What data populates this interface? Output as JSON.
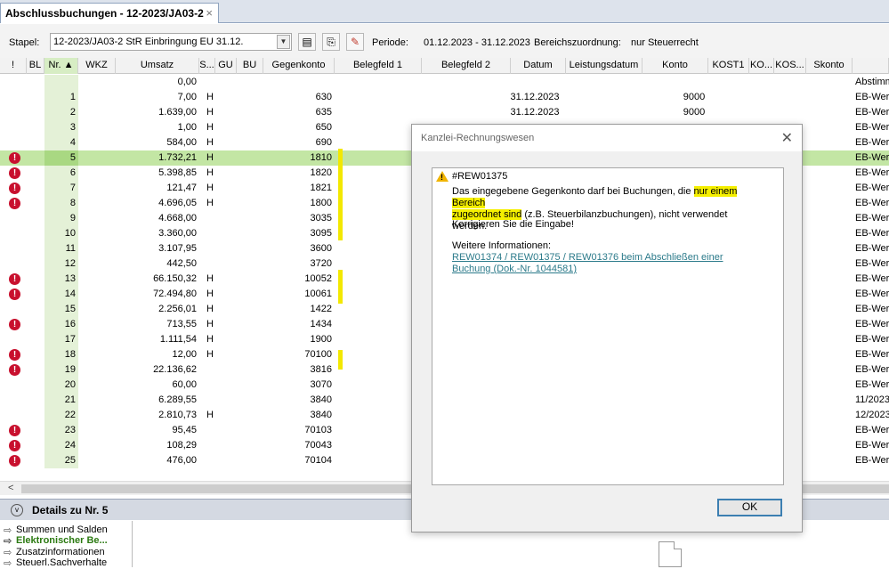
{
  "tab": {
    "title": "Abschlussbuchungen - 12-2023/JA03-2",
    "close": "×"
  },
  "toolbar": {
    "stapel_label": "Stapel:",
    "stapel_value": "12-2023/JA03-2  StR Einbringung EU 31.12.",
    "periode_label": "Periode:",
    "periode_value": "01.12.2023 - 31.12.2023",
    "bereich_label": "Bereichszuordnung:",
    "bereich_value": "nur Steuerrecht"
  },
  "columns": [
    "!",
    "BL",
    "Nr.",
    "WKZ",
    "Umsatz",
    "S...",
    "GU",
    "BU",
    "Gegenkonto",
    "Belegfeld 1",
    "Belegfeld 2",
    "Datum",
    "Leistungsdatum",
    "Konto",
    "KOST1",
    "KO...",
    "KOS...",
    "Skonto",
    ""
  ],
  "rows": [
    {
      "err": false,
      "nr": "",
      "umsatz": "0,00",
      "s": "",
      "gk": "",
      "datum": "",
      "konto": "",
      "last": "Abstimm"
    },
    {
      "err": false,
      "nr": "1",
      "umsatz": "7,00",
      "s": "H",
      "gk": "630",
      "datum": "31.12.2023",
      "konto": "9000",
      "last": "EB-Wert"
    },
    {
      "err": false,
      "nr": "2",
      "umsatz": "1.639,00",
      "s": "H",
      "gk": "635",
      "datum": "31.12.2023",
      "konto": "9000",
      "last": "EB-Wert"
    },
    {
      "err": false,
      "nr": "3",
      "umsatz": "1,00",
      "s": "H",
      "gk": "650",
      "datum": "",
      "konto": "",
      "last": "EB-Wert"
    },
    {
      "err": false,
      "nr": "4",
      "umsatz": "584,00",
      "s": "H",
      "gk": "690",
      "datum": "",
      "konto": "",
      "last": "EB-Wert"
    },
    {
      "err": true,
      "nr": "5",
      "umsatz": "1.732,21",
      "s": "H",
      "gk": "1810",
      "datum": "",
      "konto": "",
      "last": "EB-Wert"
    },
    {
      "err": true,
      "nr": "6",
      "umsatz": "5.398,85",
      "s": "H",
      "gk": "1820",
      "datum": "",
      "konto": "",
      "last": "EB-Wert"
    },
    {
      "err": true,
      "nr": "7",
      "umsatz": "121,47",
      "s": "H",
      "gk": "1821",
      "datum": "",
      "konto": "",
      "last": "EB-Wert"
    },
    {
      "err": true,
      "nr": "8",
      "umsatz": "4.696,05",
      "s": "H",
      "gk": "1800",
      "datum": "",
      "konto": "",
      "last": "EB-Wert"
    },
    {
      "err": false,
      "nr": "9",
      "umsatz": "4.668,00",
      "s": "",
      "gk": "3035",
      "datum": "",
      "konto": "",
      "last": "EB-Wert"
    },
    {
      "err": false,
      "nr": "10",
      "umsatz": "3.360,00",
      "s": "",
      "gk": "3095",
      "datum": "",
      "konto": "",
      "last": "EB-Wert"
    },
    {
      "err": false,
      "nr": "11",
      "umsatz": "3.107,95",
      "s": "",
      "gk": "3600",
      "datum": "",
      "konto": "",
      "last": "EB-Wert"
    },
    {
      "err": false,
      "nr": "12",
      "umsatz": "442,50",
      "s": "",
      "gk": "3720",
      "datum": "",
      "konto": "",
      "last": "EB-Wert"
    },
    {
      "err": true,
      "nr": "13",
      "umsatz": "66.150,32",
      "s": "H",
      "gk": "10052",
      "datum": "",
      "konto": "",
      "last": "EB-Wert"
    },
    {
      "err": true,
      "nr": "14",
      "umsatz": "72.494,80",
      "s": "H",
      "gk": "10061",
      "datum": "",
      "konto": "",
      "last": "EB-Wert"
    },
    {
      "err": false,
      "nr": "15",
      "umsatz": "2.256,01",
      "s": "H",
      "gk": "1422",
      "datum": "",
      "konto": "",
      "last": "EB-Wert"
    },
    {
      "err": true,
      "nr": "16",
      "umsatz": "713,55",
      "s": "H",
      "gk": "1434",
      "datum": "",
      "konto": "",
      "last": "EB-Wert"
    },
    {
      "err": false,
      "nr": "17",
      "umsatz": "1.111,54",
      "s": "H",
      "gk": "1900",
      "datum": "",
      "konto": "",
      "last": "EB-Wert"
    },
    {
      "err": true,
      "nr": "18",
      "umsatz": "12,00",
      "s": "H",
      "gk": "70100",
      "datum": "",
      "konto": "",
      "last": "EB-Wert"
    },
    {
      "err": true,
      "nr": "19",
      "umsatz": "22.136,62",
      "s": "",
      "gk": "3816",
      "datum": "",
      "konto": "",
      "last": "EB-Wert"
    },
    {
      "err": false,
      "nr": "20",
      "umsatz": "60,00",
      "s": "",
      "gk": "3070",
      "datum": "",
      "konto": "",
      "last": "EB-Wert"
    },
    {
      "err": false,
      "nr": "21",
      "umsatz": "6.289,55",
      "s": "",
      "gk": "3840",
      "datum": "",
      "konto": "",
      "last": "11/2023"
    },
    {
      "err": false,
      "nr": "22",
      "umsatz": "2.810,73",
      "s": "H",
      "gk": "3840",
      "datum": "",
      "konto": "",
      "last": "12/2023"
    },
    {
      "err": true,
      "nr": "23",
      "umsatz": "95,45",
      "s": "",
      "gk": "70103",
      "datum": "",
      "konto": "",
      "last": "EB-Wert"
    },
    {
      "err": true,
      "nr": "24",
      "umsatz": "108,29",
      "s": "",
      "gk": "70043",
      "datum": "",
      "konto": "",
      "last": "EB-Wert"
    },
    {
      "err": true,
      "nr": "25",
      "umsatz": "476,00",
      "s": "",
      "gk": "70104",
      "datum": "",
      "konto": "",
      "last": "EB-Wert"
    }
  ],
  "selected_nr": "5",
  "details": {
    "title": "Details zu Nr. 5",
    "nav": [
      "Summen und Salden",
      "Elektronischer Be...",
      "Zusatzinformationen",
      "Steuerl.Sachverhalte"
    ]
  },
  "dialog": {
    "title": "Kanzlei-Rechnungswesen",
    "code": "#REW01375",
    "body_1": "Das eingegebene Gegenkonto darf bei Buchungen, die ",
    "body_hl_1": "nur einem Bereich",
    "body_hl_2": "zugeordnet sind",
    "body_2": " (z.B. Steuerbilanzbuchungen), nicht verwendet werden.",
    "fix": "Korrigieren Sie die Eingabe!",
    "more": "Weitere Informationen:",
    "link": "REW01374 / REW01375 / REW01376 beim Abschließen einer Buchung (Dok.-Nr. 1044581)",
    "ok": "OK"
  }
}
